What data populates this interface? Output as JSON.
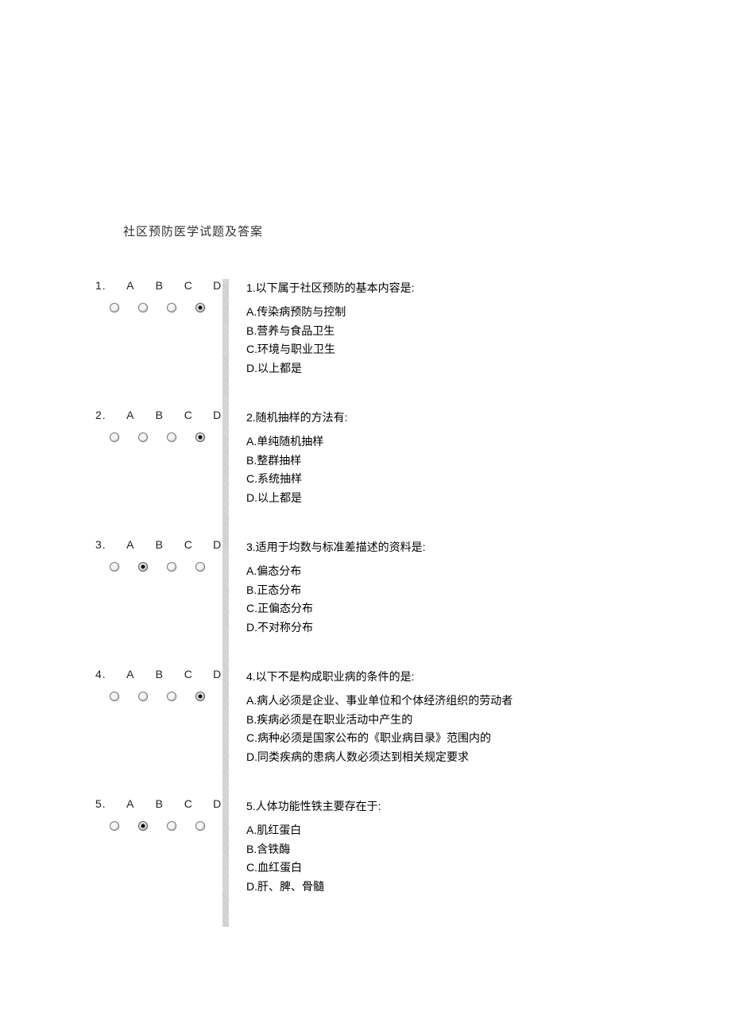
{
  "title": "社区预防医学试题及答案",
  "choice_labels": [
    "A",
    "B",
    "C",
    "D"
  ],
  "questions": [
    {
      "num": "1.",
      "selected": 3,
      "stem": "1.以下属于社区预防的基本内容是:",
      "options": [
        "A.传染病预防与控制",
        "B.营养与食品卫生",
        "C.环境与职业卫生",
        "D.以上都是"
      ]
    },
    {
      "num": "2.",
      "selected": 3,
      "stem": "2.随机抽样的方法有:",
      "options": [
        "A.单纯随机抽样",
        "B.整群抽样",
        "C.系统抽样",
        "D.以上都是"
      ]
    },
    {
      "num": "3.",
      "selected": 1,
      "stem": "3.适用于均数与标准差描述的资料是:",
      "options": [
        "A.偏态分布",
        "B.正态分布",
        "C.正偏态分布",
        "D.不对称分布"
      ]
    },
    {
      "num": "4.",
      "selected": 3,
      "stem": "4.以下不是构成职业病的条件的是:",
      "options": [
        "A.病人必须是企业、事业单位和个体经济组织的劳动者",
        "B.疾病必须是在职业活动中产生的",
        "C.病种必须是国家公布的《职业病目录》范围内的",
        "D.同类疾病的患病人数必须达到相关规定要求"
      ]
    },
    {
      "num": "5.",
      "selected": 1,
      "stem": "5.人体功能性铁主要存在于:",
      "options": [
        "A.肌红蛋白",
        "B.含铁酶",
        "C.血红蛋白",
        "D.肝、脾、骨髓"
      ]
    }
  ]
}
